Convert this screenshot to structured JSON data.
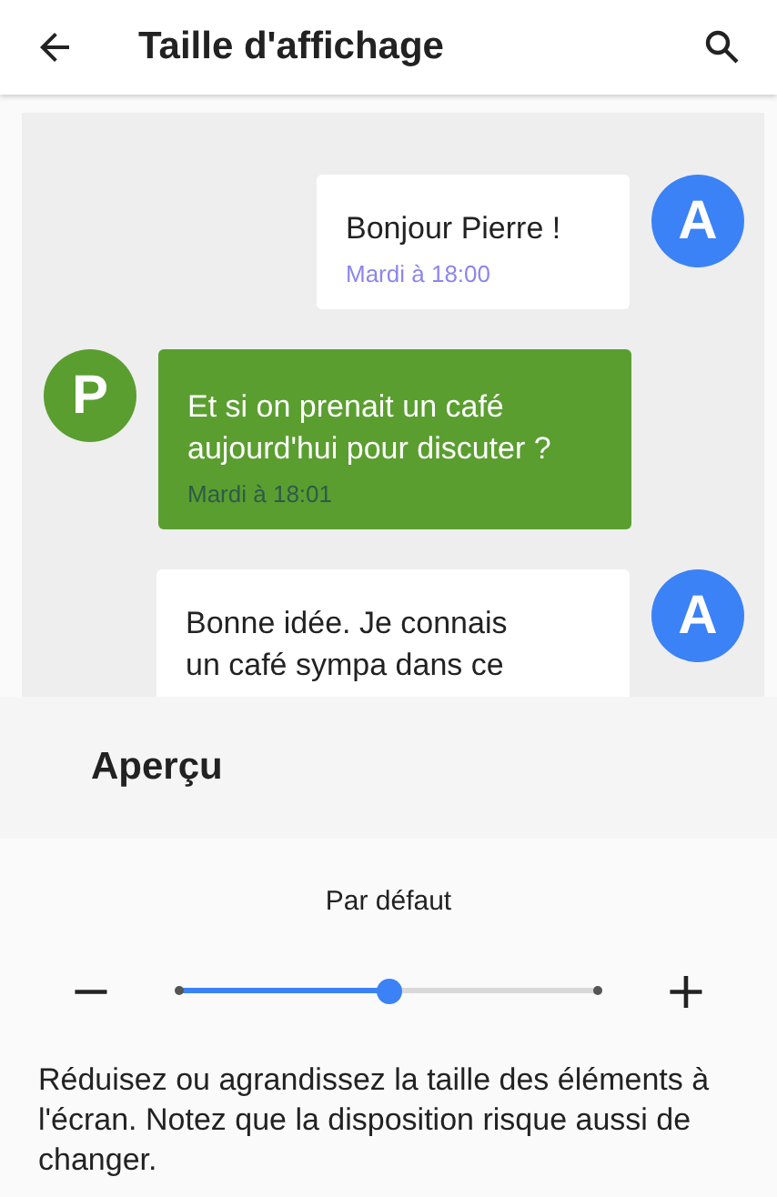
{
  "app_bar": {
    "title": "Taille d'affichage"
  },
  "messages": [
    {
      "kind": "sent",
      "avatar": "A",
      "color": "#3b82f6",
      "lines": [
        "Bonjour Pierre !"
      ],
      "time": "Mardi à 18:00"
    },
    {
      "kind": "received",
      "avatar": "P",
      "color": "#5a9e2f",
      "lines": [
        "Et si on prenait un café",
        "aujourd'hui pour discuter ?"
      ],
      "time": "Mardi à 18:01"
    },
    {
      "kind": "sent",
      "avatar": "A",
      "color": "#3b82f6",
      "lines": [
        "Bonne idée. Je connais",
        "un café sympa dans ce"
      ]
    }
  ],
  "preview_label": "Aperçu",
  "size": {
    "label": "Par défaut",
    "minus": "−",
    "plus": "+",
    "level": 0.5
  },
  "description": "Réduisez ou agrandissez la taille des éléments à l'écran. Notez que la disposition risque aussi de changer."
}
